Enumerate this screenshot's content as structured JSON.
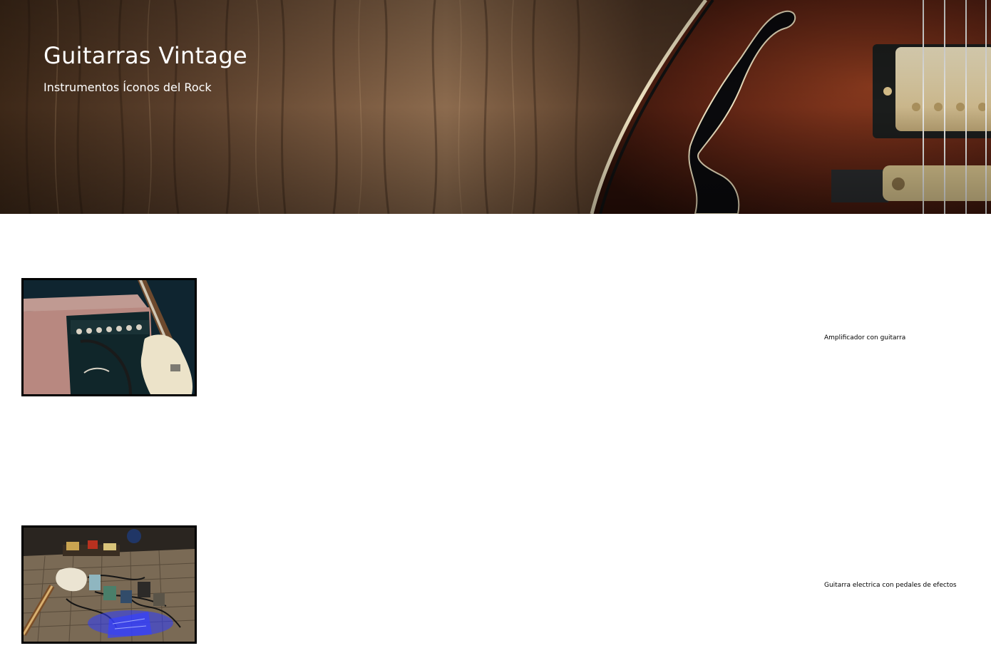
{
  "hero": {
    "title": "Guitarras Vintage",
    "subtitle": "Instrumentos Íconos del Rock",
    "image_icon": "guitar-on-wood-image"
  },
  "gallery": {
    "items": [
      {
        "image_icon": "amplifier-guitar-image",
        "caption": "Amplificador con guitarra"
      },
      {
        "image_icon": "guitar-pedals-image",
        "caption": "Guitarra electrica con pedales de efectos"
      }
    ]
  },
  "colors": {
    "wood_dark": "#3b2618",
    "wood_light": "#8a6a4c",
    "guitar_body": "#5a1e12",
    "pickup_gold": "#d9c79a",
    "text_on_hero": "#ffffff",
    "caption_text": "#000000"
  }
}
